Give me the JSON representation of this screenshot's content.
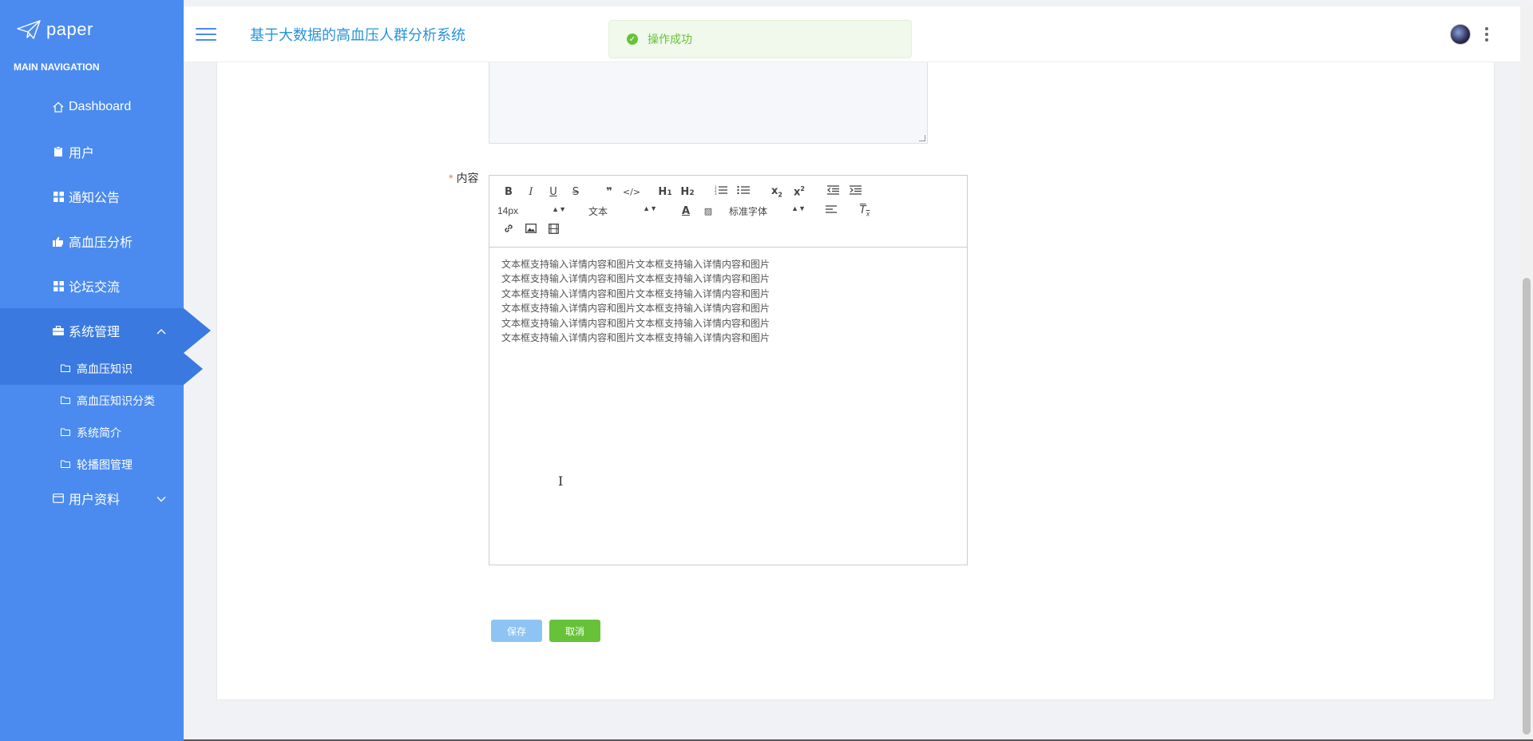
{
  "sidebar": {
    "logo_text": "paper",
    "nav_caption": "MAIN NAVIGATION",
    "items": [
      {
        "label": "Dashboard"
      },
      {
        "label": "用户"
      },
      {
        "label": "通知公告"
      },
      {
        "label": "高血压分析"
      },
      {
        "label": "论坛交流"
      },
      {
        "label": "系统管理"
      }
    ],
    "sub_items": [
      {
        "label": "高血压知识"
      },
      {
        "label": "高血压知识分类"
      },
      {
        "label": "系统简介"
      },
      {
        "label": "轮播图管理"
      }
    ],
    "user_profile": {
      "label": "用户资料"
    }
  },
  "header": {
    "title": "基于大数据的高血压人群分析系统"
  },
  "toast": {
    "message": "操作成功"
  },
  "form": {
    "content_label": "内容",
    "required_mark": "*",
    "editor": {
      "font_size": "14px",
      "block_format": "文本",
      "font_family": "标准字体",
      "lines": [
        "文本框支持输入详情内容和图片文本框支持输入详情内容和图片",
        "文本框支持输入详情内容和图片文本框支持输入详情内容和图片",
        "文本框支持输入详情内容和图片文本框支持输入详情内容和图片",
        "文本框支持输入详情内容和图片文本框支持输入详情内容和图片",
        "文本框支持输入详情内容和图片文本框支持输入详情内容和图片",
        "文本框支持输入详情内容和图片文本框支持输入详情内容和图片"
      ]
    },
    "save_label": "保存",
    "cancel_label": "取消"
  },
  "colors": {
    "sidebar_bg": "#4b8bf0",
    "sidebar_active": "#3a7ae0",
    "title_color": "#2a93d5",
    "success": "#67c23a",
    "save_btn": "#8ec4f4"
  }
}
